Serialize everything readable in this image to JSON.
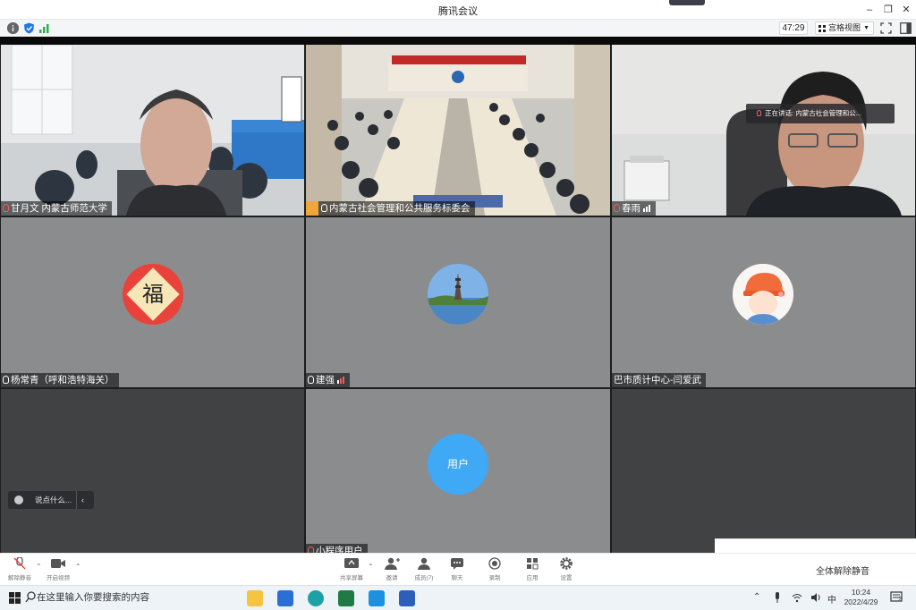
{
  "window": {
    "title": "腾讯会议"
  },
  "toolbar": {
    "timer": "47:29",
    "view_label": "宫格视图"
  },
  "participants": [
    {
      "name": "甘月文 内蒙古师范大学",
      "mic": "muted"
    },
    {
      "name": "内蒙古社会管理和公共服务标委会",
      "mic": "on"
    },
    {
      "name": "春雨",
      "mic": "on"
    },
    {
      "name": "杨常青（呼和浩特海关）",
      "mic": "on"
    },
    {
      "name": "建强",
      "mic": "on"
    },
    {
      "name": "巴市质计中心-闫爱武",
      "mic": "none"
    },
    {
      "name": "小程序用户",
      "mic": "muted"
    }
  ],
  "speaking": {
    "prefix": "正在讲话:",
    "name": "内蒙古社会管理和公..."
  },
  "avatars": {
    "fu_text": "福",
    "user_text": "用户"
  },
  "chat": {
    "placeholder": "说点什么..."
  },
  "controls": [
    {
      "label": "解除静音"
    },
    {
      "label": "开启视频"
    },
    {
      "label": "共享屏幕"
    },
    {
      "label": "邀请"
    },
    {
      "label": "成员(7)"
    },
    {
      "label": "聊天"
    },
    {
      "label": "录制"
    },
    {
      "label": "应用"
    },
    {
      "label": "设置"
    }
  ],
  "unmute_all": "全体解除静音",
  "taskbar": {
    "search_placeholder": "在这里输入你要搜索的内容",
    "ime": "中",
    "time": "10:24",
    "date": "2022/4/29",
    "notifications": "2"
  }
}
